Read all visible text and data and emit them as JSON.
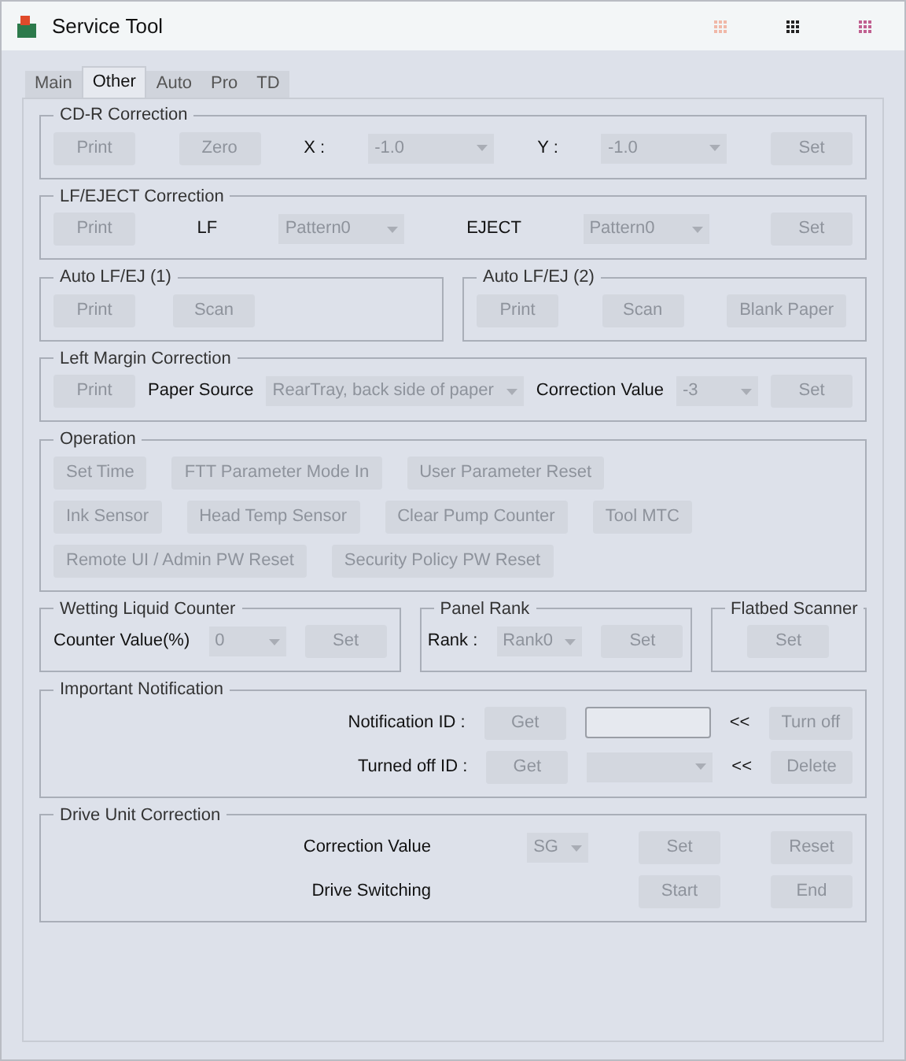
{
  "window": {
    "title": "Service Tool"
  },
  "tabs": [
    {
      "label": "Main",
      "selected": false
    },
    {
      "label": "Other",
      "selected": true
    },
    {
      "label": "Auto",
      "selected": false
    },
    {
      "label": "Pro",
      "selected": false
    },
    {
      "label": "TD",
      "selected": false
    }
  ],
  "sections": [
    {
      "groups": [
        {
          "title": "CD-R Correction",
          "rows": [
            {
              "items": [
                {
                  "kind": "button",
                  "label": "Print",
                  "disabled": true
                },
                {
                  "kind": "button",
                  "label": "Zero",
                  "disabled": true
                },
                {
                  "kind": "label",
                  "text": "X :"
                },
                {
                  "kind": "select",
                  "value": "-1.0"
                },
                {
                  "kind": "label",
                  "text": "Y :"
                },
                {
                  "kind": "select",
                  "value": "-1.0"
                },
                {
                  "kind": "button",
                  "label": "Set",
                  "disabled": true
                }
              ]
            }
          ]
        }
      ]
    },
    {
      "groups": [
        {
          "title": "LF/EJECT Correction",
          "rows": [
            {
              "items": [
                {
                  "kind": "button",
                  "label": "Print",
                  "disabled": true
                },
                {
                  "kind": "label",
                  "text": "LF"
                },
                {
                  "kind": "select",
                  "value": "Pattern0"
                },
                {
                  "kind": "label",
                  "text": "EJECT"
                },
                {
                  "kind": "select",
                  "value": "Pattern0"
                },
                {
                  "kind": "button",
                  "label": "Set",
                  "disabled": true
                }
              ]
            }
          ]
        }
      ]
    },
    {
      "groups": [
        {
          "title": "Auto LF/EJ (1)",
          "rows": [
            {
              "items": [
                {
                  "kind": "button",
                  "label": "Print",
                  "disabled": true
                },
                {
                  "kind": "button",
                  "label": "Scan",
                  "disabled": true
                }
              ]
            }
          ]
        },
        {
          "title": "Auto LF/EJ (2)",
          "rows": [
            {
              "items": [
                {
                  "kind": "button",
                  "label": "Print",
                  "disabled": true
                },
                {
                  "kind": "button",
                  "label": "Scan",
                  "disabled": true
                },
                {
                  "kind": "button",
                  "label": "Blank Paper",
                  "disabled": true
                }
              ]
            }
          ]
        }
      ]
    },
    {
      "groups": [
        {
          "title": "Left Margin Correction",
          "rows": [
            {
              "items": [
                {
                  "kind": "button",
                  "label": "Print",
                  "disabled": true
                },
                {
                  "kind": "label",
                  "text": "Paper Source"
                },
                {
                  "kind": "select",
                  "value": "RearTray, back side of paper"
                },
                {
                  "kind": "label",
                  "text": "Correction Value"
                },
                {
                  "kind": "select",
                  "value": "-3"
                },
                {
                  "kind": "button",
                  "label": "Set",
                  "disabled": true
                }
              ]
            }
          ]
        }
      ]
    },
    {
      "groups": [
        {
          "title": "Operation",
          "rows": [
            {
              "items": [
                {
                  "kind": "button",
                  "label": "Set Time",
                  "disabled": true
                },
                {
                  "kind": "button",
                  "label": "FTT Parameter Mode In",
                  "disabled": true
                },
                {
                  "kind": "button",
                  "label": "User Parameter Reset",
                  "disabled": true
                }
              ]
            },
            {
              "items": [
                {
                  "kind": "button",
                  "label": "Ink Sensor",
                  "disabled": true
                },
                {
                  "kind": "button",
                  "label": "Head Temp Sensor",
                  "disabled": true
                },
                {
                  "kind": "button",
                  "label": "Clear Pump Counter",
                  "disabled": true
                },
                {
                  "kind": "button",
                  "label": "Tool MTC",
                  "disabled": true
                }
              ]
            },
            {
              "items": [
                {
                  "kind": "button",
                  "label": "Remote UI / Admin PW Reset",
                  "disabled": true
                },
                {
                  "kind": "button",
                  "label": "Security Policy PW Reset",
                  "disabled": true
                }
              ]
            }
          ]
        }
      ]
    },
    {
      "groups": [
        {
          "title": "Wetting Liquid Counter",
          "rows": [
            {
              "items": [
                {
                  "kind": "label",
                  "text": "Counter Value(%)"
                },
                {
                  "kind": "select",
                  "value": "0"
                },
                {
                  "kind": "button",
                  "label": "Set",
                  "disabled": true
                }
              ]
            }
          ]
        },
        {
          "title": "Panel Rank",
          "rows": [
            {
              "items": [
                {
                  "kind": "label",
                  "text": "Rank :"
                },
                {
                  "kind": "select",
                  "value": "Rank0"
                },
                {
                  "kind": "button",
                  "label": "Set",
                  "disabled": true
                }
              ]
            }
          ]
        },
        {
          "title": "Flatbed Scanner",
          "rows": [
            {
              "items": [
                {
                  "kind": "button",
                  "label": "Set",
                  "disabled": true
                }
              ]
            }
          ]
        }
      ]
    },
    {
      "groups": [
        {
          "title": "Important Notification",
          "rows": [
            {
              "items": [
                {
                  "kind": "label",
                  "text": "Notification ID :"
                },
                {
                  "kind": "button",
                  "label": "Get",
                  "disabled": true
                },
                {
                  "kind": "field"
                },
                {
                  "kind": "label",
                  "text": "<<"
                },
                {
                  "kind": "button",
                  "label": "Turn off",
                  "disabled": true
                }
              ]
            },
            {
              "items": [
                {
                  "kind": "label",
                  "text": "Turned off ID :"
                },
                {
                  "kind": "button",
                  "label": "Get",
                  "disabled": true
                },
                {
                  "kind": "select"
                },
                {
                  "kind": "label",
                  "text": "<<"
                },
                {
                  "kind": "button",
                  "label": "Delete",
                  "disabled": true
                }
              ]
            }
          ]
        }
      ]
    },
    {
      "groups": [
        {
          "title": "Drive Unit Correction",
          "rows": [
            {
              "items": [
                {
                  "kind": "label",
                  "text": "Correction Value"
                },
                {
                  "kind": "select",
                  "value": "SG"
                },
                {
                  "kind": "button",
                  "label": "Set",
                  "disabled": true
                },
                {
                  "kind": "button",
                  "label": "Reset",
                  "disabled": true
                }
              ]
            },
            {
              "items": [
                {
                  "kind": "label",
                  "text": "Drive Switching"
                },
                {
                  "kind": "button",
                  "label": "Start",
                  "disabled": true
                },
                {
                  "kind": "button",
                  "label": "End",
                  "disabled": true
                }
              ]
            }
          ]
        }
      ]
    }
  ]
}
